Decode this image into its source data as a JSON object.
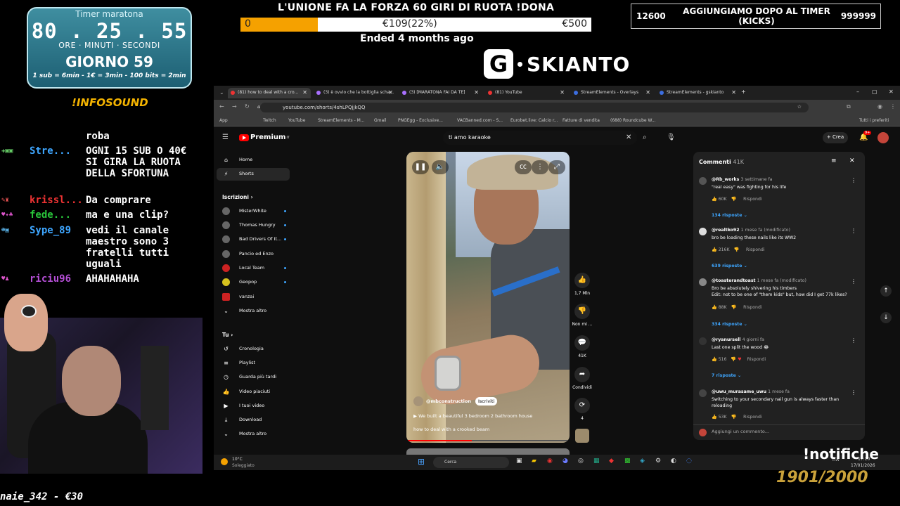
{
  "timer": {
    "title": "Timer maratona",
    "hours": "80",
    "minutes": "25",
    "seconds": "55",
    "sep1": ".",
    "sep2": ".",
    "label_hours": "ORE",
    "label_minutes": "MINUTI",
    "label_seconds": "SECONDI",
    "day": "GIORNO 59",
    "rates": "1 sub = 6min - 1€ = 3min - 100 bits = 2min"
  },
  "infosound": "!INFOSOUND",
  "chat": [
    {
      "user": "",
      "msg": "roba"
    },
    {
      "user": "Stre...",
      "msg": "OGNI 15 SUB O 40€ SI GIRA LA RUOTA DELLA SFORTUNA"
    },
    {
      "user": "krissl...",
      "msg": "Da comprare"
    },
    {
      "user": "fede...",
      "msg": "ma e una clip?"
    },
    {
      "user": "Sype_89",
      "msg": "vedi il canale maestro sono 3 fratelli tutti uguali"
    },
    {
      "user": "riciu96",
      "msg": "AHAHAHAHA"
    }
  ],
  "wheel": {
    "title": "L'UNIONE FA LA FORZA 60 GIRI DI RUOTA !DONA",
    "min": "0",
    "current": "€109(22%)",
    "max": "€500",
    "progress": 0.22,
    "status": "Ended 4 months ago"
  },
  "kicks": {
    "left": "12600",
    "title": "AGGIUNGIAMO DOPO AL TIMER (KICKS)",
    "right": "999999"
  },
  "brand": {
    "g": "G",
    "name": "SKIANTO"
  },
  "browser": {
    "tabs": [
      "(81) how to deal with a cro...",
      "(3) è ovvio che la bottiglia scha...",
      "(3) [MARATONA FAI DA TE]",
      "(81) YouTube",
      "StreamElements - Overlays",
      "StreamElements - gskianto"
    ],
    "url": "youtube.com/shorts/4shLPQjjkQQ",
    "bookmarks": [
      "App",
      "Twitch",
      "YouTube",
      "StreamElements - M...",
      "Gmail",
      "PNGEgg - Exclusive...",
      "VACBanned.com - S...",
      "Eurobet.live: Calcio r...",
      "Fatture di vendita",
      "(688) Roundcube W..."
    ],
    "bookmarks_right": "Tutti i preferiti"
  },
  "youtube": {
    "logo": "Premium",
    "logo_sup": "IT",
    "search_value": "ti amo karaoke",
    "create": "Crea",
    "notif_badge": "9+",
    "sidebar": {
      "home": "Home",
      "shorts": "Shorts",
      "subs_header": "Iscrizioni",
      "channels": [
        "MisterWhite",
        "Thomas Hungry",
        "Bad Drivers Of It...",
        "Pancio ed Enzo",
        "Local Team",
        "Geopop",
        "vanzai"
      ],
      "show_more": "Mostra altro",
      "you_header": "Tu",
      "you_items": [
        "Cronologia",
        "Playlist",
        "Guarda più tardi",
        "Video piaciuti",
        "I tuoi video",
        "Download"
      ],
      "show_more2": "Mostra altro"
    },
    "video": {
      "channel": "@mbconstruction",
      "subscribe": "Iscriviti",
      "desc": "We built a beautiful 3 bedroom 2 bathroom house",
      "title": "how to deal with a crooked beam",
      "progress": 0.4
    },
    "actions": {
      "likes": "1,7 Mln",
      "dislike": "Non mi ...",
      "comments": "41K",
      "share": "Condividi",
      "remix": "4"
    },
    "comments": {
      "title": "Commenti",
      "count": "41K",
      "reply_label": "Rispondi",
      "add_placeholder": "Aggiungi un commento...",
      "items": [
        {
          "user": "@Rb_works",
          "time": "3 settimane fa",
          "text": "\"real easy\" was fighting for his life",
          "likes": "60K",
          "replies": "134 risposte"
        },
        {
          "user": "@realtko92",
          "time": "1 mese fa (modificato)",
          "text": "bro be loading these nails like its WW2",
          "likes": "216K",
          "replies": "639 risposte"
        },
        {
          "user": "@toasterandtoast",
          "time": "1 mese fa (modificato)",
          "text": "Bro be absolutely shivering his timbers\nEdit: not to be one of \"them kids\" but, how did I get 77k likes?",
          "likes": "88K",
          "replies": "334 risposte"
        },
        {
          "user": "@ryanursell",
          "time": "4 giorni fa",
          "text": "Last one split the wood 😂",
          "likes": "516",
          "replies": "7 risposte"
        },
        {
          "user": "@uwu_murasame_uwu",
          "time": "1 mese fa",
          "text": "Switching to your secondary nail gun is always faster than reloading",
          "likes": "53K",
          "replies": ""
        }
      ]
    }
  },
  "taskbar": {
    "temp": "10°C",
    "weather": "Soleggiato",
    "search": "Cerca",
    "lang": "ITA",
    "time": "17:10",
    "date": "17/01/2026"
  },
  "overlay": {
    "notifiche": "!notifiche",
    "sub_count": "1901/2000",
    "donation": "naie_342 - €30"
  }
}
